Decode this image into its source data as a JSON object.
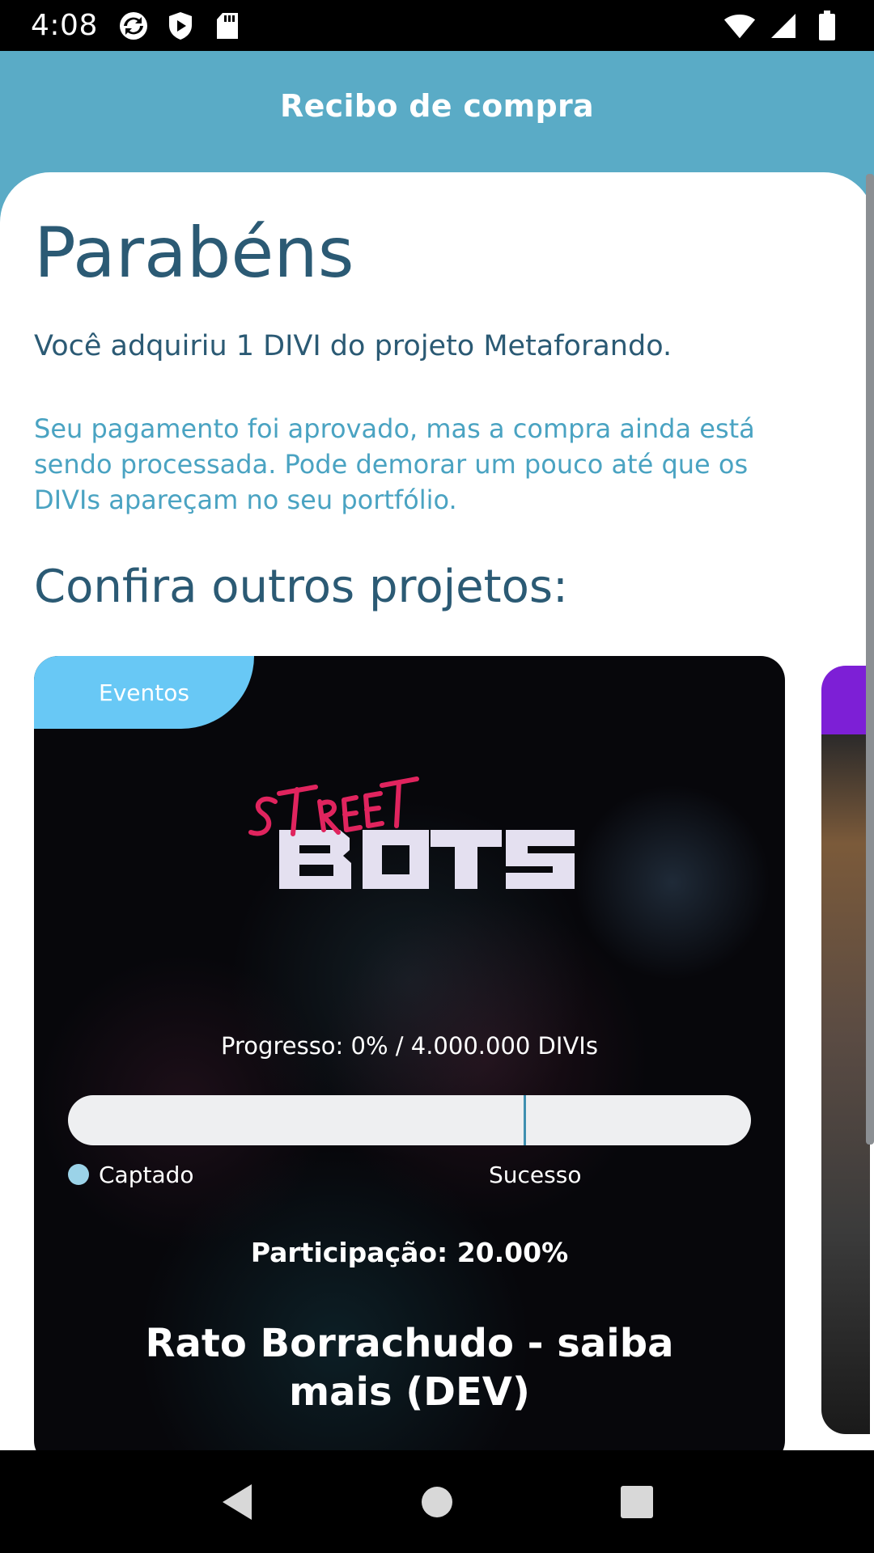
{
  "status_bar": {
    "time": "4:08",
    "left_icons": [
      "sync-icon",
      "shield-icon",
      "sd-card-icon"
    ],
    "right_icons": [
      "wifi-icon",
      "signal-icon",
      "battery-icon"
    ]
  },
  "header": {
    "title": "Recibo de compra"
  },
  "receipt": {
    "congrats": "Parabéns",
    "purchase_line": "Você adquiriu 1 DIVI do projeto Metaforando.",
    "processing_note": "Seu pagamento foi aprovado, mas a compra ainda está sendo processada. Pode demorar um pouco até que os DIVIs apareçam no seu portfólio."
  },
  "other_projects": {
    "title": "Confira outros projetos:",
    "cards": [
      {
        "category": "Eventos",
        "logo_top": "STREET",
        "logo_bottom": "BOTS",
        "progress_text": "Progresso: 0% / 4.000.000 DIVIs",
        "progress_fraction": 0,
        "success_threshold_fraction": 0.667,
        "legend_raised": "Captado",
        "legend_success": "Sucesso",
        "participation": "Participação: 20.00%",
        "name": "Rato Borrachudo - saiba mais (DEV)"
      }
    ]
  },
  "nav": {
    "buttons": [
      "back-icon",
      "home-icon",
      "recents-icon"
    ]
  },
  "colors": {
    "header": "#5aabc6",
    "title_text": "#2b5a74",
    "info_text": "#4aa3c2",
    "tag": "#68c8f5",
    "logo_pink": "#e0245e",
    "logo_white": "#e4e0f0"
  }
}
